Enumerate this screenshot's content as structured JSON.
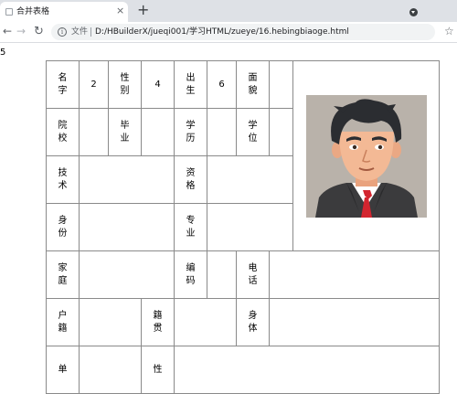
{
  "browser": {
    "tab_title": "合并表格",
    "tab_close": "×",
    "new_tab": "+",
    "nav": {
      "back": "←",
      "forward": "→",
      "reload": "↻"
    },
    "omnibox": {
      "info": "i",
      "file_label": "文件",
      "url": "D:/HBuilderX/jueqi001/学习HTML/zueye/16.hebingbiaoge.html"
    },
    "star": "☆"
  },
  "page": {
    "stray_text": "5",
    "table": {
      "row1": {
        "name_label": [
          "名",
          "字"
        ],
        "name_value": "2",
        "gender_label": [
          "性",
          "别"
        ],
        "gender_value": "4",
        "birth_label": [
          "出",
          "生"
        ],
        "birth_value": "6",
        "appearance_label": [
          "面",
          "貌"
        ]
      },
      "row2": {
        "school_label": [
          "院",
          "校"
        ],
        "graduate_label": [
          "毕",
          "业"
        ],
        "education_label": [
          "学",
          "历"
        ],
        "degree_label": [
          "学",
          "位"
        ]
      },
      "row3": {
        "skill_label": [
          "技",
          "术"
        ],
        "qualification_label": [
          "资",
          "格"
        ]
      },
      "row4": {
        "identity_label": [
          "身",
          "份"
        ],
        "major_label": [
          "专",
          "业"
        ]
      },
      "row5": {
        "home_label": [
          "家",
          "庭"
        ],
        "code_label": [
          "编",
          "码"
        ],
        "phone_label": [
          "电",
          "话"
        ]
      },
      "row6": {
        "household_label": [
          "户",
          "籍"
        ],
        "origin_label": [
          "籍",
          "贯"
        ],
        "body_label": [
          "身",
          "体"
        ]
      },
      "row7": {
        "unit_label": [
          "单"
        ],
        "nature_label": [
          "性"
        ]
      }
    }
  },
  "colors": {
    "tabstrip": "#dee1e6",
    "border": "#8a8a8a",
    "avatar_bg": "#b9b2aa",
    "tie": "#d3252f"
  },
  "icons": {
    "avatar": "cartoon-man-avatar",
    "info": "info-icon",
    "star": "bookmark-star-icon"
  }
}
